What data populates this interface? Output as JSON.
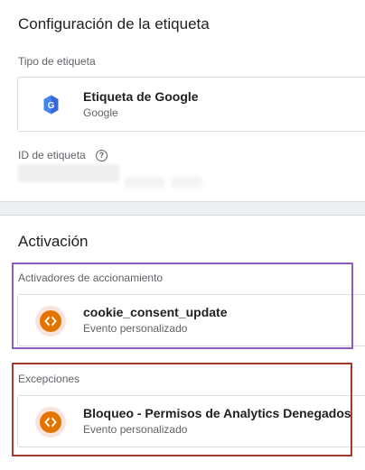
{
  "config": {
    "title": "Configuración de la etiqueta",
    "type_label": "Tipo de etiqueta",
    "tag_type": {
      "title": "Etiqueta de Google",
      "subtitle": "Google",
      "icon": "google-tag-icon"
    },
    "id_label": "ID de etiqueta",
    "id_help_glyph": "?"
  },
  "activation": {
    "title": "Activación",
    "triggers_label": "Activadores de accionamiento",
    "trigger": {
      "title": "cookie_consent_update",
      "subtitle": "Evento personalizado",
      "icon": "custom-event-icon"
    },
    "exceptions_label": "Excepciones",
    "exception": {
      "title": "Bloqueo - Permisos de Analytics Denegados",
      "subtitle": "Evento personalizado",
      "icon": "custom-event-icon"
    }
  },
  "colors": {
    "trigger_icon": "#e37400",
    "trigger_halo": "#fde3dd",
    "google_tag_blue": "#4285f4",
    "highlight_purple": "#8e5cc4",
    "highlight_red": "#a33a2c"
  }
}
